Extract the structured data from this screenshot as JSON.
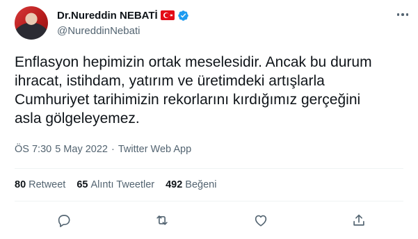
{
  "author": {
    "name": "Dr.Nureddin NEBATİ",
    "handle": "@NureddinNebati",
    "badges": [
      "turkey-flag-icon",
      "verified-badge-icon"
    ]
  },
  "tweet": {
    "text": "Enflasyon hepimizin ortak meselesidir. Ancak bu durum\nihracat, istihdam, yatırım ve üretimdeki artışlarla\nCumhuriyet tarihimizin rekorlarını kırdığımız gerçeğini\nasla gölgeleyemez."
  },
  "meta": {
    "time": "ÖS 7:30",
    "separator": "·",
    "date": "5 May 2022",
    "source": "Twitter Web App"
  },
  "stats": {
    "retweets_count": "80",
    "retweets_label": "Retweet",
    "quotes_count": "65",
    "quotes_label": "Alıntı Tweetler",
    "likes_count": "492",
    "likes_label": "Beğeni"
  },
  "actions": [
    "reply-icon",
    "retweet-icon",
    "like-icon",
    "share-icon"
  ],
  "colors": {
    "text": "#0f1419",
    "secondary": "#536471",
    "verified": "#1d9bf0",
    "flag": "#e30a17",
    "divider": "#eff3f4"
  }
}
